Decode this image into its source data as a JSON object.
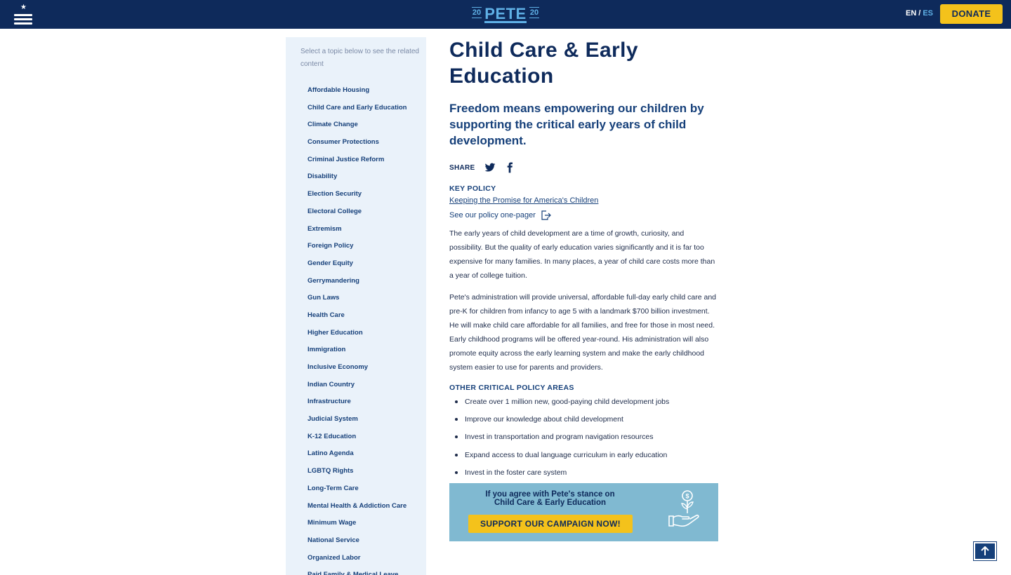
{
  "header": {
    "logo": {
      "year_left": "20",
      "word": "PETE",
      "year_right": "20"
    },
    "lang_en": "EN",
    "lang_sep": "/",
    "lang_es": "ES",
    "donate_label": "DONATE"
  },
  "sidebar": {
    "hint": "Select a topic below to see the related content",
    "topics": [
      "Affordable Housing",
      "Child Care and Early Education",
      "Climate Change",
      "Consumer Protections",
      "Criminal Justice Reform",
      "Disability",
      "Election Security",
      "Electoral College",
      "Extremism",
      "Foreign Policy",
      "Gender Equity",
      "Gerrymandering",
      "Gun Laws",
      "Health Care",
      "Higher Education",
      "Immigration",
      "Inclusive Economy",
      "Indian Country",
      "Infrastructure",
      "Judicial System",
      "K-12 Education",
      "Latino Agenda",
      "LGBTQ Rights",
      "Long-Term Care",
      "Mental Health & Addiction Care",
      "Minimum Wage",
      "National Service",
      "Organized Labor",
      "Paid Family & Medical Leave"
    ]
  },
  "main": {
    "title": "Child Care & Early Education",
    "subtitle": "Freedom means empowering our children by supporting the critical early years of child development.",
    "share_label": "SHARE",
    "key_policy_heading": "KEY POLICY",
    "key_policy_link": "Keeping the Promise for America's Children",
    "one_pager_label": "See our policy one-pager",
    "paragraph_1": "The early years of child development are a time of growth, curiosity, and possibility. But the quality of early education varies significantly and it is far too expensive for many families. In many places, a year of child care costs more than a year of college tuition.",
    "paragraph_2": "Pete's administration will provide universal, affordable full-day early child care and pre-K for children from infancy to age 5 with a landmark $700 billion investment. He will make child care affordable for all families, and free for those in most need. Early childhood programs will be offered year-round. His administration will also promote equity across the early learning system and make the early childhood system easier to use for parents and providers.",
    "other_heading": "OTHER CRITICAL POLICY AREAS",
    "other_items": [
      "Create over 1 million new, good-paying child development jobs",
      "Improve our knowledge about child development",
      "Invest in transportation and program navigation resources",
      "Expand access to dual language curriculum in early education",
      "Invest in the foster care system"
    ]
  },
  "cta": {
    "line1": "If you agree with Pete's stance on",
    "line2": "Child Care & Early Education",
    "button_label": "SUPPORT OUR CAMPAIGN NOW!"
  },
  "icons": {
    "menu": "hamburger-menu-icon",
    "twitter": "twitter-icon",
    "facebook": "facebook-icon",
    "external": "external-link-icon",
    "money_plant": "hand-money-plant-icon",
    "back_to_top": "arrow-up-icon"
  },
  "colors": {
    "navy": "#0e2a5b",
    "link_blue": "#16407a",
    "light_blue": "#5fb0e6",
    "yellow": "#f4c21b",
    "sidebar_bg": "#eaf2fa",
    "cta_bg": "#80b9d1"
  }
}
